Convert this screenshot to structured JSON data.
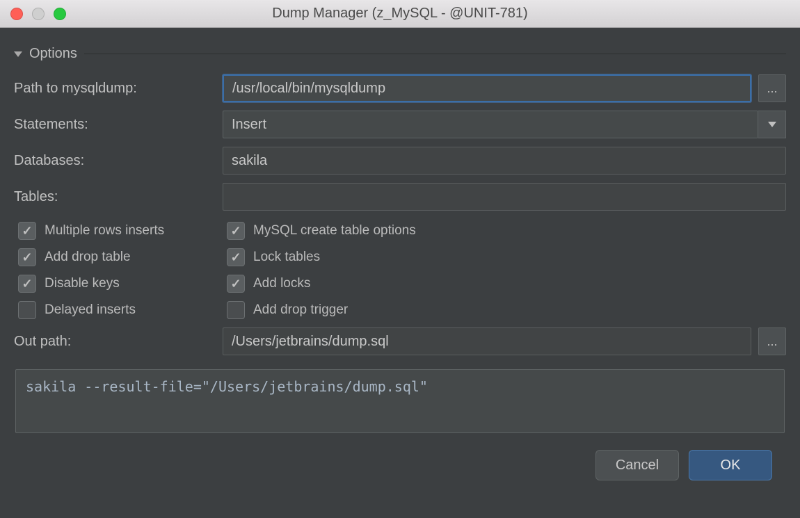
{
  "window": {
    "title": "Dump Manager (z_MySQL - @UNIT-781)"
  },
  "section": {
    "title": "Options"
  },
  "labels": {
    "path": "Path to mysqldump:",
    "statements": "Statements:",
    "databases": "Databases:",
    "tables": "Tables:",
    "outpath": "Out path:"
  },
  "values": {
    "path": "/usr/local/bin/mysqldump",
    "statements": "Insert",
    "databases": "sakila",
    "tables": "",
    "outpath": "/Users/jetbrains/dump.sql"
  },
  "checks": {
    "multiple_rows": {
      "label": "Multiple rows inserts",
      "checked": true
    },
    "add_drop_table": {
      "label": "Add drop table",
      "checked": true
    },
    "disable_keys": {
      "label": "Disable keys",
      "checked": true
    },
    "delayed_inserts": {
      "label": "Delayed inserts",
      "checked": false
    },
    "mysql_create_table": {
      "label": "MySQL create table options",
      "checked": true
    },
    "lock_tables": {
      "label": "Lock tables",
      "checked": true
    },
    "add_locks": {
      "label": "Add locks",
      "checked": true
    },
    "add_drop_trigger": {
      "label": "Add drop trigger",
      "checked": false
    }
  },
  "preview": "sakila --result-file=\"/Users/jetbrains/dump.sql\"",
  "buttons": {
    "browse": "...",
    "cancel": "Cancel",
    "ok": "OK"
  }
}
